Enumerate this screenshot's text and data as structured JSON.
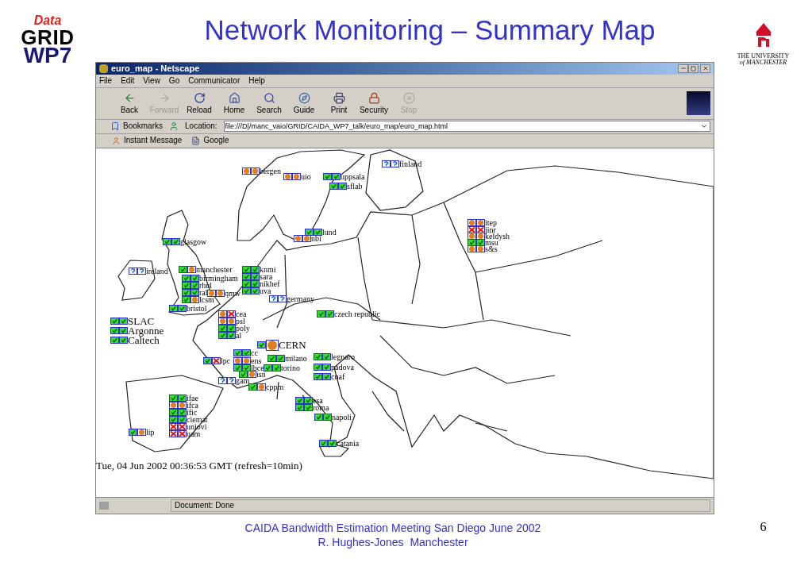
{
  "slide": {
    "title": "Network Monitoring – Summary Map",
    "logo": {
      "top": "Data",
      "main": "GRID",
      "sub": "WP7"
    },
    "university": {
      "line1": "THE UNIVERSITY",
      "line2": "of MANCHESTER"
    },
    "footer": [
      "CAIDA Bandwidth Estimation Meeting San Diego June 2002",
      "R. Hughes-Jones  Manchester"
    ],
    "page_number": "6"
  },
  "window": {
    "title": "euro_map - Netscape"
  },
  "menu": [
    "File",
    "Edit",
    "View",
    "Go",
    "Communicator",
    "Help"
  ],
  "toolbar": [
    {
      "kind": "back",
      "label": "Back",
      "disabled": false
    },
    {
      "kind": "forward",
      "label": "Forward",
      "disabled": true
    },
    {
      "kind": "reload",
      "label": "Reload",
      "disabled": false
    },
    {
      "kind": "home",
      "label": "Home",
      "disabled": false
    },
    {
      "kind": "search",
      "label": "Search",
      "disabled": false
    },
    {
      "kind": "guide",
      "label": "Guide",
      "disabled": false
    },
    {
      "kind": "print",
      "label": "Print",
      "disabled": false
    },
    {
      "kind": "security",
      "label": "Security",
      "disabled": false
    },
    {
      "kind": "stop",
      "label": "Stop",
      "disabled": true
    }
  ],
  "location_bar": {
    "bookmarks": "Bookmarks",
    "label": "Location:",
    "value": "file:///D|/manc_vaio/GRID/CAIDA_WP7_talk/euro_map/euro_map.html"
  },
  "personal_toolbar": [
    "Instant Message",
    "Google"
  ],
  "map": {
    "sites": [
      {
        "name": "bergen",
        "kind": "small",
        "status": [
          {
            "kind": "slow"
          },
          {
            "kind": "slow"
          }
        ]
      },
      {
        "name": "uio",
        "kind": "small",
        "status": [
          {
            "kind": "slow"
          },
          {
            "kind": "slow"
          }
        ]
      },
      {
        "name": "uppsala",
        "kind": "small",
        "status": [
          {
            "kind": "ok"
          },
          {
            "kind": "ok"
          }
        ]
      },
      {
        "name": "sflab",
        "kind": "small",
        "status": [
          {
            "kind": "ok"
          },
          {
            "kind": "ok"
          }
        ]
      },
      {
        "name": "finland",
        "kind": "small",
        "status": [
          {
            "kind": "unknown"
          },
          {
            "kind": "unknown"
          }
        ]
      },
      {
        "name": "lund",
        "kind": "small",
        "status": [
          {
            "kind": "ok"
          },
          {
            "kind": "ok"
          }
        ]
      },
      {
        "name": "nbi",
        "kind": "small",
        "status": [
          {
            "kind": "slow"
          },
          {
            "kind": "slow"
          }
        ]
      },
      {
        "name": "itep",
        "kind": "small",
        "status": [
          {
            "kind": "slow"
          },
          {
            "kind": "slow"
          }
        ]
      },
      {
        "name": "jinr",
        "kind": "small",
        "status": [
          {
            "kind": "down"
          },
          {
            "kind": "down"
          }
        ]
      },
      {
        "name": "keldysh",
        "kind": "small",
        "status": [
          {
            "kind": "slow"
          },
          {
            "kind": "slow"
          }
        ]
      },
      {
        "name": "msu",
        "kind": "small",
        "status": [
          {
            "kind": "ok"
          },
          {
            "kind": "ok"
          }
        ]
      },
      {
        "name": "s&s",
        "kind": "small",
        "status": [
          {
            "kind": "slow"
          },
          {
            "kind": "slow"
          }
        ]
      },
      {
        "name": "glasgow",
        "kind": "small",
        "status": [
          {
            "kind": "ok"
          },
          {
            "kind": "ok"
          }
        ]
      },
      {
        "name": "ireland",
        "kind": "small",
        "status": [
          {
            "kind": "unknown"
          },
          {
            "kind": "unknown"
          }
        ]
      },
      {
        "name": "manchester",
        "kind": "small",
        "status": [
          {
            "kind": "ok"
          },
          {
            "kind": "slow"
          }
        ]
      },
      {
        "name": "birmingham",
        "kind": "small",
        "status": [
          {
            "kind": "ok"
          },
          {
            "kind": "ok"
          }
        ]
      },
      {
        "name": "rhul",
        "kind": "small",
        "status": [
          {
            "kind": "ok"
          },
          {
            "kind": "ok"
          }
        ]
      },
      {
        "name": "ral",
        "kind": "small",
        "status": [
          {
            "kind": "ok"
          },
          {
            "kind": "ok"
          }
        ]
      },
      {
        "name": "qmw",
        "kind": "small",
        "status": [
          {
            "kind": "slow"
          },
          {
            "kind": "slow"
          }
        ]
      },
      {
        "name": "lcsm",
        "kind": "small",
        "status": [
          {
            "kind": "ok"
          },
          {
            "kind": "slow"
          }
        ]
      },
      {
        "name": "bristol",
        "kind": "small",
        "status": [
          {
            "kind": "ok"
          },
          {
            "kind": "ok"
          }
        ]
      },
      {
        "name": "knmi",
        "kind": "small",
        "status": [
          {
            "kind": "ok"
          },
          {
            "kind": "ok"
          }
        ]
      },
      {
        "name": "sara",
        "kind": "small",
        "status": [
          {
            "kind": "ok"
          },
          {
            "kind": "ok"
          }
        ]
      },
      {
        "name": "nikhef",
        "kind": "small",
        "status": [
          {
            "kind": "ok"
          },
          {
            "kind": "ok"
          }
        ]
      },
      {
        "name": "uva",
        "kind": "small",
        "status": [
          {
            "kind": "ok"
          },
          {
            "kind": "ok"
          }
        ]
      },
      {
        "name": "germany",
        "kind": "small",
        "status": [
          {
            "kind": "unknown"
          },
          {
            "kind": "unknown"
          }
        ]
      },
      {
        "name": "czech republic",
        "kind": "small",
        "status": [
          {
            "kind": "ok"
          },
          {
            "kind": "ok"
          }
        ]
      },
      {
        "name": "SLAC",
        "kind": "large",
        "status": [
          {
            "kind": "ok"
          },
          {
            "kind": "ok"
          }
        ]
      },
      {
        "name": "Argonne",
        "kind": "large",
        "status": [
          {
            "kind": "ok"
          },
          {
            "kind": "ok"
          }
        ]
      },
      {
        "name": "Caltech",
        "kind": "large",
        "status": [
          {
            "kind": "ok"
          },
          {
            "kind": "ok"
          }
        ]
      },
      {
        "name": "cea",
        "kind": "small",
        "status": [
          {
            "kind": "slow"
          },
          {
            "kind": "down"
          }
        ]
      },
      {
        "name": "psl",
        "kind": "small",
        "status": [
          {
            "kind": "slow"
          },
          {
            "kind": "slow"
          }
        ]
      },
      {
        "name": "poly",
        "kind": "small",
        "status": [
          {
            "kind": "ok"
          },
          {
            "kind": "ok"
          }
        ]
      },
      {
        "name": "al",
        "kind": "small",
        "status": [
          {
            "kind": "ok"
          },
          {
            "kind": "ok"
          }
        ]
      },
      {
        "name": "CERN",
        "kind": "large",
        "status": [
          {
            "kind": "ok"
          },
          {
            "kind": "slow"
          }
        ]
      },
      {
        "name": "cc",
        "kind": "small",
        "status": [
          {
            "kind": "ok"
          },
          {
            "kind": "ok"
          }
        ]
      },
      {
        "name": "lpc",
        "kind": "small",
        "status": [
          {
            "kind": "ok"
          },
          {
            "kind": "down"
          }
        ]
      },
      {
        "name": "ens",
        "kind": "small",
        "status": [
          {
            "kind": "slow"
          },
          {
            "kind": "slow"
          }
        ]
      },
      {
        "name": "lbce",
        "kind": "small",
        "status": [
          {
            "kind": "ok"
          },
          {
            "kind": "ok"
          }
        ]
      },
      {
        "name": "isn",
        "kind": "small",
        "status": [
          {
            "kind": "ok"
          },
          {
            "kind": "slow"
          }
        ]
      },
      {
        "name": "gam",
        "kind": "small",
        "status": [
          {
            "kind": "unknown"
          },
          {
            "kind": "unknown"
          }
        ]
      },
      {
        "name": "cppm",
        "kind": "small",
        "status": [
          {
            "kind": "ok"
          },
          {
            "kind": "slow"
          }
        ]
      },
      {
        "name": "milano",
        "kind": "small",
        "status": [
          {
            "kind": "ok"
          },
          {
            "kind": "ok"
          }
        ]
      },
      {
        "name": "torino",
        "kind": "small",
        "status": [
          {
            "kind": "ok"
          },
          {
            "kind": "ok"
          }
        ]
      },
      {
        "name": "legnaro",
        "kind": "small",
        "status": [
          {
            "kind": "ok"
          },
          {
            "kind": "ok"
          }
        ]
      },
      {
        "name": "padova",
        "kind": "small",
        "status": [
          {
            "kind": "ok"
          },
          {
            "kind": "ok"
          }
        ]
      },
      {
        "name": "cnaf",
        "kind": "small",
        "status": [
          {
            "kind": "ok"
          },
          {
            "kind": "ok"
          }
        ]
      },
      {
        "name": "esa",
        "kind": "small",
        "status": [
          {
            "kind": "ok"
          },
          {
            "kind": "ok"
          }
        ]
      },
      {
        "name": "roma",
        "kind": "small",
        "status": [
          {
            "kind": "ok"
          },
          {
            "kind": "ok"
          }
        ]
      },
      {
        "name": "napoli",
        "kind": "small",
        "status": [
          {
            "kind": "ok"
          },
          {
            "kind": "ok"
          }
        ]
      },
      {
        "name": "catania",
        "kind": "small",
        "status": [
          {
            "kind": "ok"
          },
          {
            "kind": "ok"
          }
        ]
      },
      {
        "name": "ifae",
        "kind": "small",
        "status": [
          {
            "kind": "ok"
          },
          {
            "kind": "ok"
          }
        ]
      },
      {
        "name": "ifca",
        "kind": "small",
        "status": [
          {
            "kind": "slow"
          },
          {
            "kind": "slow"
          }
        ]
      },
      {
        "name": "ific",
        "kind": "small",
        "status": [
          {
            "kind": "ok"
          },
          {
            "kind": "ok"
          }
        ]
      },
      {
        "name": "ciemat",
        "kind": "small",
        "status": [
          {
            "kind": "ok"
          },
          {
            "kind": "ok"
          }
        ]
      },
      {
        "name": "uniovi",
        "kind": "small",
        "status": [
          {
            "kind": "down"
          },
          {
            "kind": "down"
          }
        ]
      },
      {
        "name": "uam",
        "kind": "small",
        "status": [
          {
            "kind": "down"
          },
          {
            "kind": "down"
          }
        ]
      },
      {
        "name": "lip",
        "kind": "small",
        "status": [
          {
            "kind": "ok"
          },
          {
            "kind": "slow"
          }
        ]
      }
    ],
    "timestamp": "Tue, 04 Jun 2002 00:36:53 GMT (refresh=10min)"
  },
  "status_bar": "Document: Done"
}
